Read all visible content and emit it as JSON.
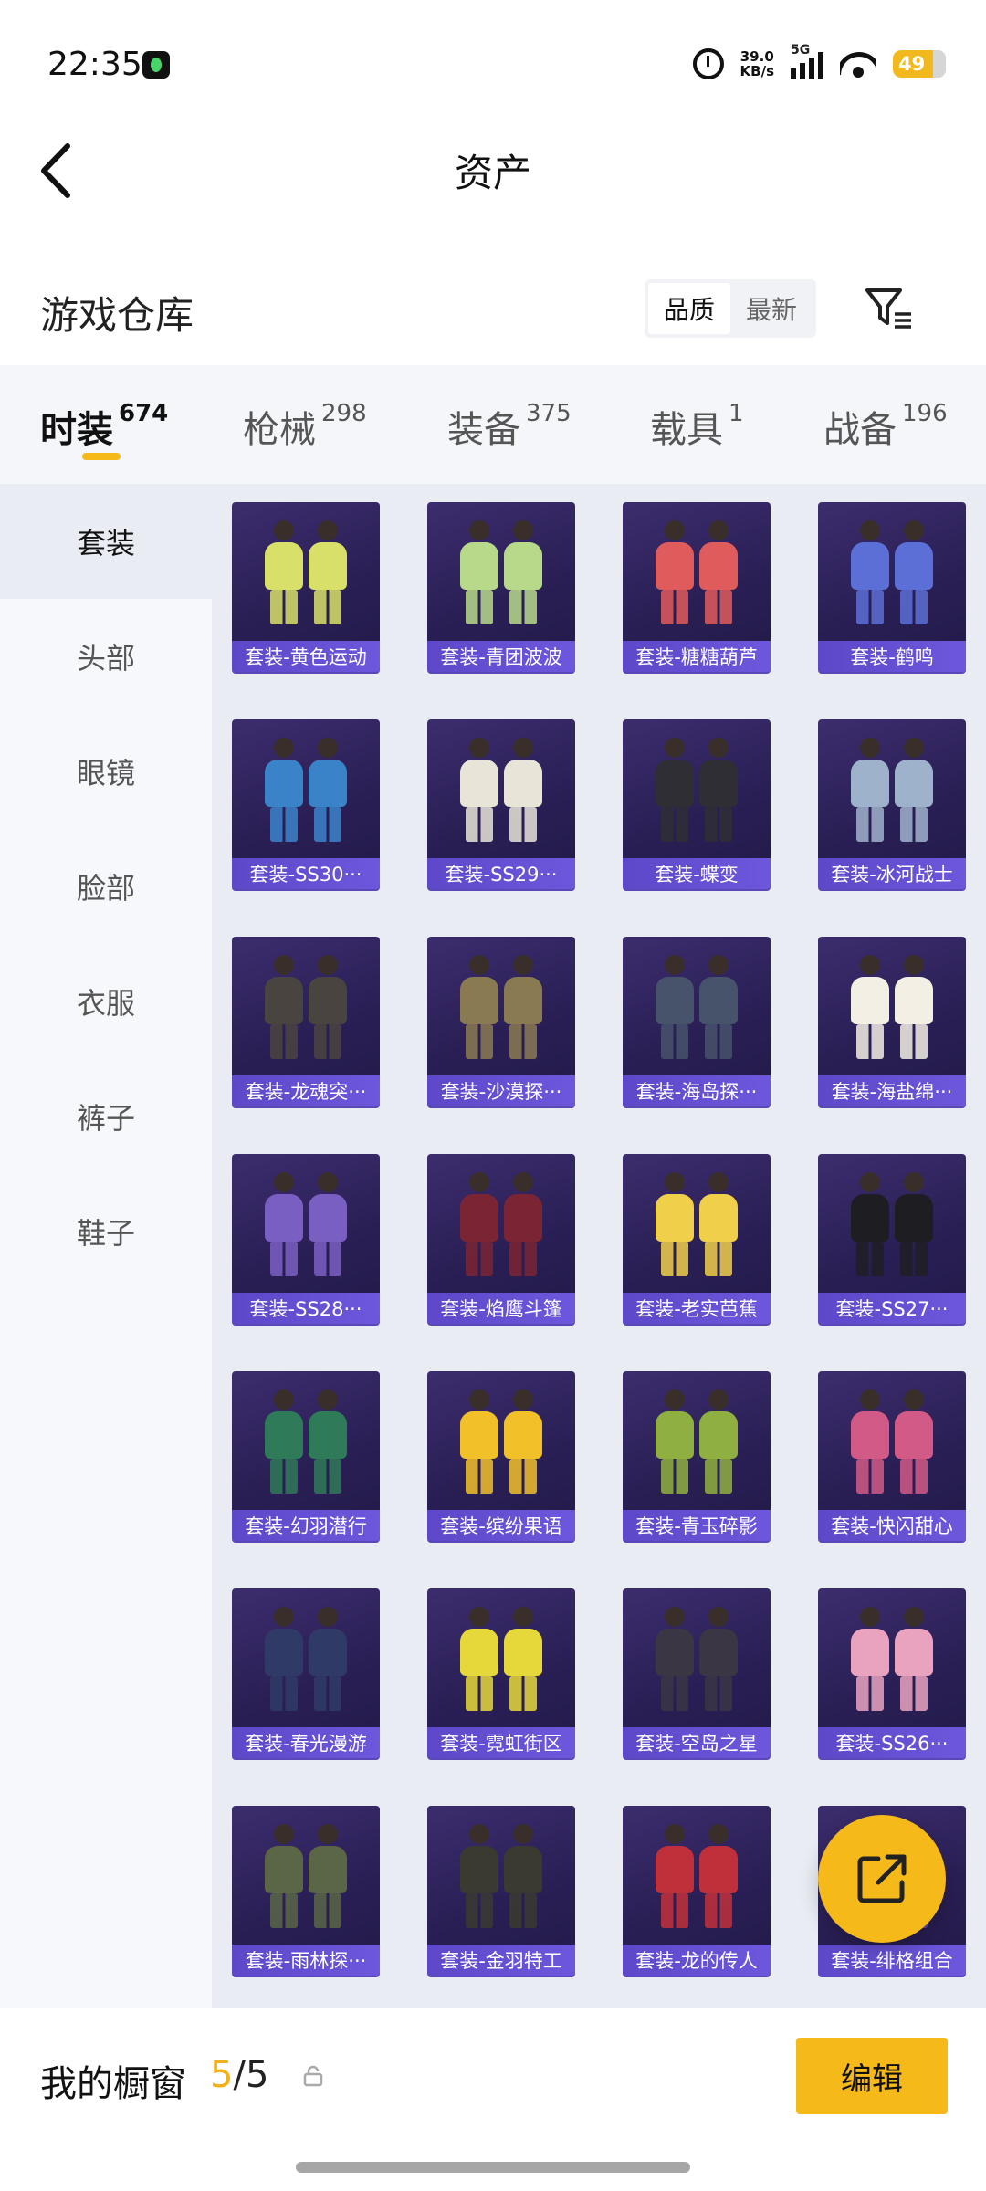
{
  "status_bar": {
    "time": "22:35",
    "net_speed_value": "39.0",
    "net_speed_unit": "KB/s",
    "network": "5G",
    "battery": "49"
  },
  "header": {
    "title": "资产",
    "back_icon": "chevron-left-icon"
  },
  "warehouse": {
    "title": "游戏仓库",
    "sort_options": [
      "品质",
      "最新"
    ],
    "sort_selected": "品质",
    "filter_icon": "filter-icon"
  },
  "tabs": [
    {
      "label": "时装",
      "count": "674",
      "active": true
    },
    {
      "label": "枪械",
      "count": "298",
      "active": false
    },
    {
      "label": "装备",
      "count": "375",
      "active": false
    },
    {
      "label": "载具",
      "count": "1",
      "active": false
    },
    {
      "label": "战备",
      "count": "196",
      "active": false
    }
  ],
  "sidebar": [
    {
      "label": "套装",
      "active": true
    },
    {
      "label": "头部",
      "active": false
    },
    {
      "label": "眼镜",
      "active": false
    },
    {
      "label": "脸部",
      "active": false
    },
    {
      "label": "衣服",
      "active": false
    },
    {
      "label": "裤子",
      "active": false
    },
    {
      "label": "鞋子",
      "active": false
    }
  ],
  "items": [
    {
      "name": "套装-黄色运动",
      "color": "#d9e06a"
    },
    {
      "name": "套装-青团波波",
      "color": "#b9d98a"
    },
    {
      "name": "套装-糖糖葫芦",
      "color": "#e05b5b"
    },
    {
      "name": "套装-鹤鸣",
      "color": "#5b6fd6"
    },
    {
      "name": "套装-SS30···",
      "color": "#3b83c9"
    },
    {
      "name": "套装-SS29···",
      "color": "#e8e4d8"
    },
    {
      "name": "套装-蝶变",
      "color": "#2e2e34"
    },
    {
      "name": "套装-冰河战士",
      "color": "#9fb2cc"
    },
    {
      "name": "套装-龙魂突···",
      "color": "#4a4440"
    },
    {
      "name": "套装-沙漠探···",
      "color": "#8a7a52"
    },
    {
      "name": "套装-海岛探···",
      "color": "#46536a"
    },
    {
      "name": "套装-海盐绵···",
      "color": "#f3efe4"
    },
    {
      "name": "套装-SS28···",
      "color": "#7a5fc2"
    },
    {
      "name": "套装-焰鹰斗篷",
      "color": "#7a2434"
    },
    {
      "name": "套装-老实芭蕉",
      "color": "#f0cf4a"
    },
    {
      "name": "套装-SS27···",
      "color": "#1e1e22"
    },
    {
      "name": "套装-幻羽潜行",
      "color": "#2f7a58"
    },
    {
      "name": "套装-缤纷果语",
      "color": "#f2c12a"
    },
    {
      "name": "套装-青玉碎影",
      "color": "#8fb040"
    },
    {
      "name": "套装-快闪甜心",
      "color": "#d25a86"
    },
    {
      "name": "套装-春光漫游",
      "color": "#2f3b66"
    },
    {
      "name": "套装-霓虹街区",
      "color": "#e6d83a"
    },
    {
      "name": "套装-空岛之星",
      "color": "#3a3644"
    },
    {
      "name": "套装-SS26···",
      "color": "#e9a3bf"
    },
    {
      "name": "套装-雨林探···",
      "color": "#5a6646"
    },
    {
      "name": "套装-金羽特工",
      "color": "#3a3a30"
    },
    {
      "name": "套装-龙的传人",
      "color": "#c0303a"
    },
    {
      "name": "套装-绯格组合",
      "color": "#6a4dbd"
    }
  ],
  "share_icon": "share-external-icon",
  "showcase": {
    "label": "我的橱窗",
    "current": "5",
    "separator": "/",
    "total": "5",
    "lock_icon": "lock-icon"
  },
  "edit_button_label": "编辑"
}
